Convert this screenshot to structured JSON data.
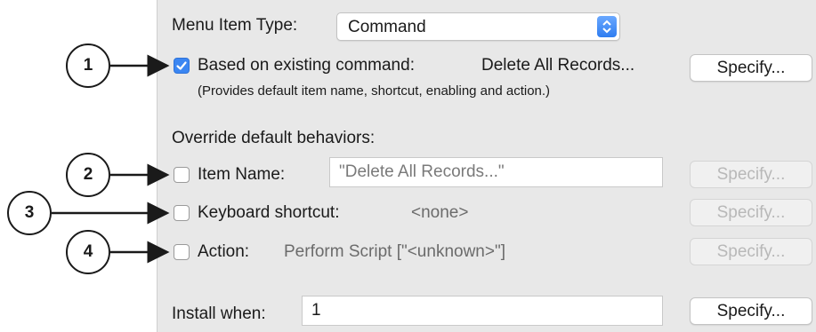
{
  "menu_item_type": {
    "label": "Menu Item Type:",
    "value": "Command"
  },
  "based_on": {
    "checked": true,
    "label": "Based on existing command:",
    "command": "Delete All Records...",
    "description": "(Provides default item name, shortcut, enabling and action.)",
    "specify_label": "Specify..."
  },
  "override": {
    "heading": "Override default behaviors:",
    "item_name": {
      "checked": false,
      "label": "Item Name:",
      "value": "\"Delete All Records...\"",
      "specify_label": "Specify..."
    },
    "keyboard_shortcut": {
      "checked": false,
      "label": "Keyboard shortcut:",
      "value": "<none>",
      "specify_label": "Specify..."
    },
    "action": {
      "checked": false,
      "label": "Action:",
      "value": "Perform Script [\"<unknown>\"]",
      "specify_label": "Specify..."
    }
  },
  "install_when": {
    "label": "Install when:",
    "value": "1",
    "specify_label": "Specify..."
  },
  "callouts": [
    "1",
    "2",
    "3",
    "4"
  ],
  "colors": {
    "accent": "#3b86f2",
    "panel": "#e8e8e8",
    "disabled_text": "#b8b8b8"
  }
}
